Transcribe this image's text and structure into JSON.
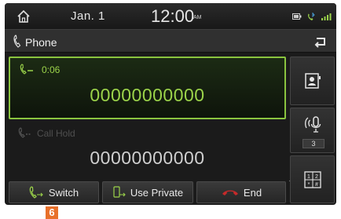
{
  "status_bar": {
    "date": "Jan.  1",
    "time": "12:00",
    "ampm": "AM",
    "icons": [
      "home-icon",
      "battery-icon",
      "bluetooth-phone-icon",
      "signal-icon"
    ]
  },
  "header": {
    "title": "Phone",
    "icon": "phone-icon",
    "back_icon": "back-arrow-icon"
  },
  "active_call": {
    "duration": "0:06",
    "number": "00000000000",
    "icon": "call-active-icon"
  },
  "held_call": {
    "label": "Call Hold",
    "number": "00000000000",
    "icon": "call-hold-icon"
  },
  "buttons": {
    "switch": "Switch",
    "use_private": "Use Private",
    "end": "End"
  },
  "side_panel": {
    "mute_level": "3",
    "panel_arrow": "‹"
  },
  "step_badge": "6",
  "colors": {
    "accent_green": "#9bd34a",
    "end_red": "#c62a2a",
    "badge_orange": "#e8702a"
  }
}
